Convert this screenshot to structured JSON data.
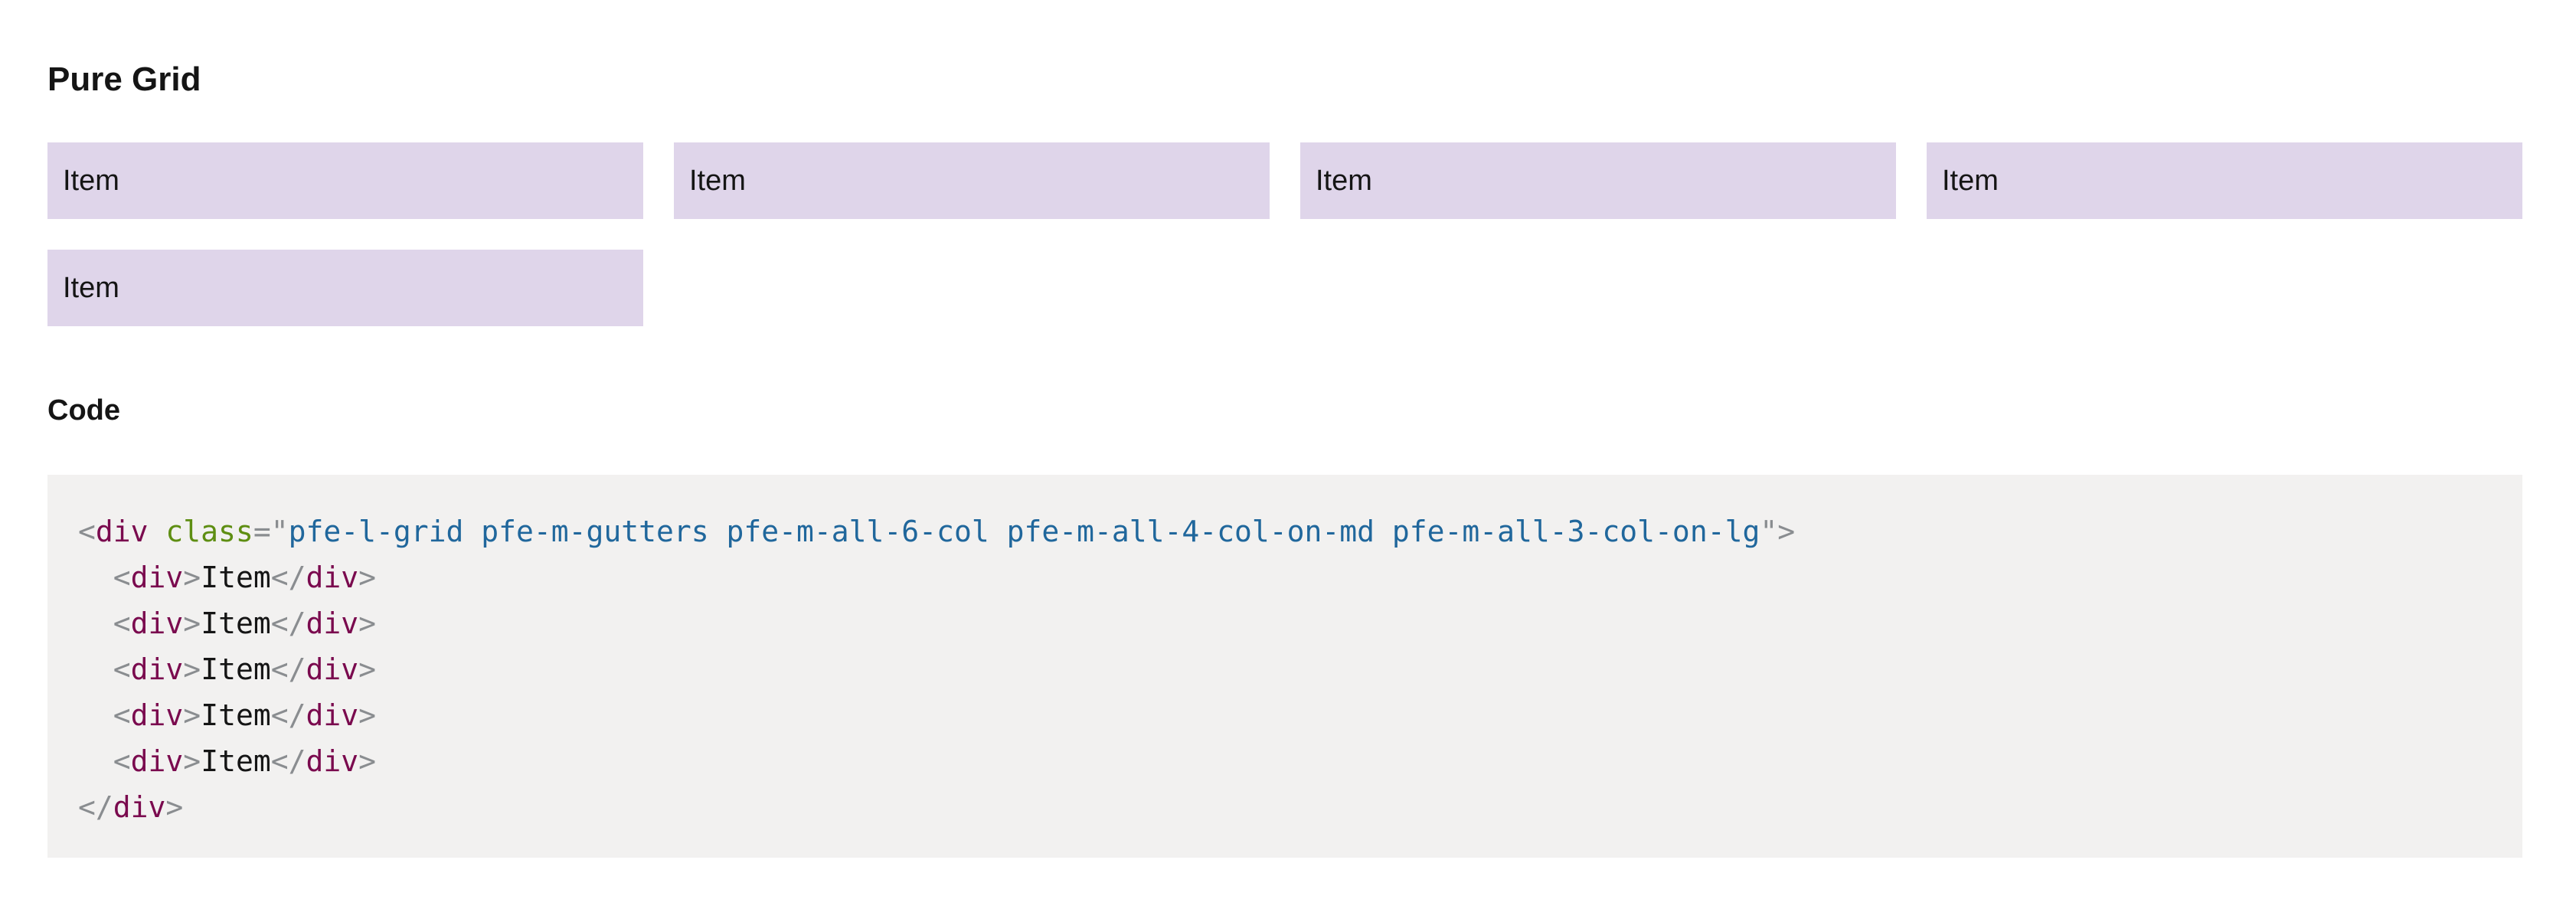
{
  "page": {
    "title": "Pure Grid"
  },
  "grid": {
    "items": [
      "Item",
      "Item",
      "Item",
      "Item",
      "Item"
    ]
  },
  "code": {
    "heading": "Code",
    "open_bracket": "<",
    "close_bracket": ">",
    "close_tag_open": "</",
    "tag": "div",
    "attr_name": "class",
    "attr_eq_quote": "=\"",
    "quote": "\"",
    "attr_value": "pfe-l-grid pfe-m-gutters pfe-m-all-6-col pfe-m-all-4-col-on-md pfe-m-all-3-col-on-lg",
    "indent": "  ",
    "inner_lines": [
      "Item",
      "Item",
      "Item",
      "Item",
      "Item"
    ]
  },
  "colors": {
    "grid_item_bg": "#dfd5ea",
    "code_bg": "#f2f1f0",
    "tag": "#7a0a4e",
    "attr": "#5e8e12",
    "value": "#20679c",
    "punct": "#8a8d90"
  }
}
